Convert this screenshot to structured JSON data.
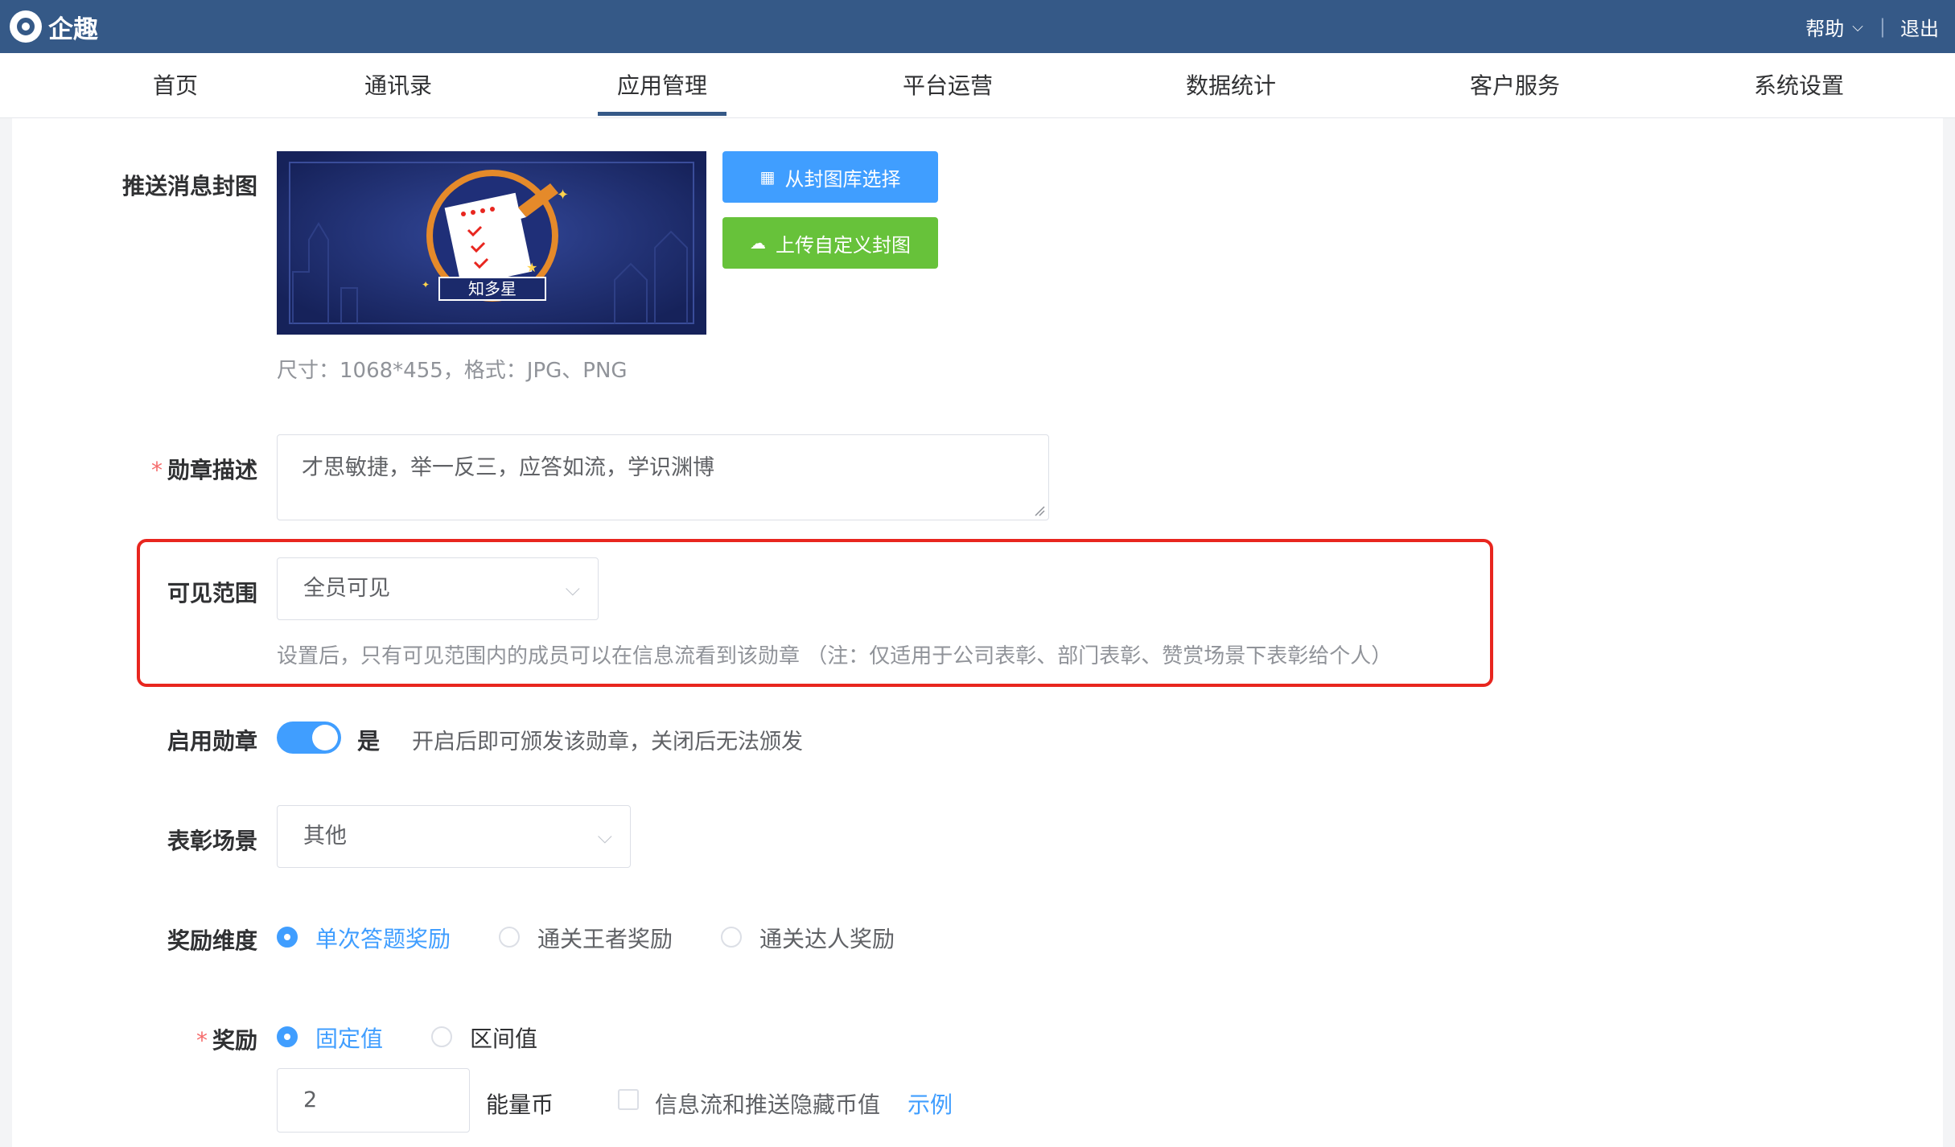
{
  "header": {
    "app_name": "企趣",
    "help_label": "帮助",
    "logout_label": "退出"
  },
  "nav": {
    "items": [
      "首页",
      "通讯录",
      "应用管理",
      "平台运营",
      "数据统计",
      "客户服务",
      "系统设置"
    ],
    "active": "应用管理"
  },
  "form": {
    "cover": {
      "label": "推送消息封图",
      "image_caption": "知多星",
      "select_library_button": "从封图库选择",
      "upload_button": "上传自定义封图",
      "hint": "尺寸：1068*455，格式：JPG、PNG"
    },
    "description": {
      "required": "*",
      "label": "勋章描述",
      "value": "才思敏捷，举一反三，应答如流，学识渊博"
    },
    "visibility": {
      "label": "可见范围",
      "selected": "全员可见",
      "hint": "设置后，只有可见范围内的成员可以在信息流看到该勋章 （注：仅适用于公司表彰、部门表彰、赞赏场景下表彰给个人）"
    },
    "enable": {
      "label": "启用勋章",
      "switch_on": true,
      "status": "是",
      "hint": "开启后即可颁发该勋章，关闭后无法颁发"
    },
    "scene": {
      "label": "表彰场景",
      "selected": "其他"
    },
    "reward_dimension": {
      "label": "奖励维度",
      "options": [
        "单次答题奖励",
        "通关王者奖励",
        "通关达人奖励"
      ],
      "selected": "单次答题奖励"
    },
    "reward": {
      "required": "*",
      "label": "奖励",
      "options": [
        "固定值",
        "区间值"
      ],
      "selected": "固定值",
      "amount": "2",
      "unit": "能量币",
      "hide_checkbox_label": "信息流和推送隐藏币值",
      "hide_checked": false,
      "example_link": "示例"
    }
  },
  "colors": {
    "topbar": "#355987",
    "primary": "#409eff",
    "success": "#67c23a",
    "highlight_border": "#e8261f"
  }
}
